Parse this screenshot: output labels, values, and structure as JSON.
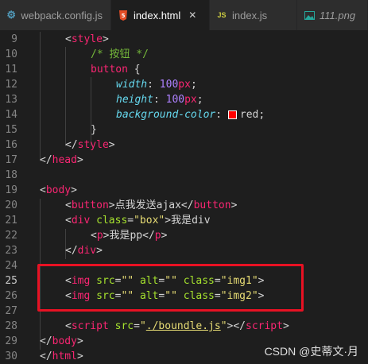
{
  "tabs": [
    {
      "label": "webpack.config.js",
      "icon": "gear-icon"
    },
    {
      "label": "index.html",
      "icon": "html5-icon",
      "close": "✕"
    },
    {
      "label": "index.js",
      "icon": "js-icon"
    },
    {
      "label": "111.png",
      "icon": "image-icon"
    }
  ],
  "lines": [
    {
      "n": "9",
      "t": [
        [
          "<",
          "br"
        ],
        [
          "style",
          "tag"
        ],
        [
          ">",
          "br"
        ]
      ]
    },
    {
      "n": "10",
      "t": [
        [
          "/* 按钮 */",
          "com"
        ]
      ]
    },
    {
      "n": "11",
      "t": [
        [
          "button",
          "sel"
        ],
        [
          " {",
          "br"
        ]
      ]
    },
    {
      "n": "12",
      "t": [
        [
          "width",
          "prop"
        ],
        [
          ": ",
          "br"
        ],
        [
          "100",
          "num"
        ],
        [
          "px",
          "unit"
        ],
        [
          ";",
          "br"
        ]
      ]
    },
    {
      "n": "13",
      "t": [
        [
          "height",
          "prop"
        ],
        [
          ": ",
          "br"
        ],
        [
          "100",
          "num"
        ],
        [
          "px",
          "unit"
        ],
        [
          ";",
          "br"
        ]
      ]
    },
    {
      "n": "14",
      "t": [
        [
          "background-color",
          "prop"
        ],
        [
          ": ",
          "br"
        ],
        [
          "",
          "swatch"
        ],
        [
          "red",
          "br"
        ],
        [
          ";",
          "br"
        ]
      ]
    },
    {
      "n": "15",
      "t": [
        [
          "}",
          "br"
        ]
      ]
    },
    {
      "n": "16",
      "t": [
        [
          "</",
          "br"
        ],
        [
          "style",
          "tag"
        ],
        [
          ">",
          "br"
        ]
      ]
    },
    {
      "n": "17",
      "t": [
        [
          "</",
          "br"
        ],
        [
          "head",
          "tag"
        ],
        [
          ">",
          "br"
        ]
      ]
    },
    {
      "n": "18",
      "t": []
    },
    {
      "n": "19",
      "t": [
        [
          "<",
          "br"
        ],
        [
          "body",
          "tag"
        ],
        [
          ">",
          "br"
        ]
      ]
    },
    {
      "n": "20",
      "t": [
        [
          "<",
          "br"
        ],
        [
          "button",
          "tag"
        ],
        [
          ">点我发送ajax</",
          "br"
        ],
        [
          "button",
          "tag"
        ],
        [
          ">",
          "br"
        ]
      ]
    },
    {
      "n": "21",
      "t": [
        [
          "<",
          "br"
        ],
        [
          "div",
          "tag"
        ],
        [
          " ",
          "br"
        ],
        [
          "class",
          "attr"
        ],
        [
          "=",
          "br"
        ],
        [
          "\"box\"",
          "str"
        ],
        [
          ">我是div",
          "br"
        ]
      ]
    },
    {
      "n": "22",
      "t": [
        [
          "<",
          "br"
        ],
        [
          "p",
          "tag"
        ],
        [
          ">我是pp</",
          "br"
        ],
        [
          "p",
          "tag"
        ],
        [
          ">",
          "br"
        ]
      ]
    },
    {
      "n": "23",
      "t": [
        [
          "</",
          "br"
        ],
        [
          "div",
          "tag"
        ],
        [
          ">",
          "br"
        ]
      ]
    },
    {
      "n": "24",
      "t": []
    },
    {
      "n": "25",
      "t": [
        [
          "<",
          "br"
        ],
        [
          "img",
          "tag"
        ],
        [
          " ",
          "br"
        ],
        [
          "src",
          "attr"
        ],
        [
          "=",
          "br"
        ],
        [
          "\"\"",
          "str"
        ],
        [
          " ",
          "br"
        ],
        [
          "alt",
          "attr"
        ],
        [
          "=",
          "br"
        ],
        [
          "\"\"",
          "str"
        ],
        [
          " ",
          "br"
        ],
        [
          "class",
          "attr"
        ],
        [
          "=",
          "br"
        ],
        [
          "\"img1\"",
          "str"
        ],
        [
          ">",
          "br"
        ]
      ]
    },
    {
      "n": "26",
      "t": [
        [
          "<",
          "br"
        ],
        [
          "img",
          "tag"
        ],
        [
          " ",
          "br"
        ],
        [
          "src",
          "attr"
        ],
        [
          "=",
          "br"
        ],
        [
          "\"\"",
          "str"
        ],
        [
          " ",
          "br"
        ],
        [
          "alt",
          "attr"
        ],
        [
          "=",
          "br"
        ],
        [
          "\"\"",
          "str"
        ],
        [
          " ",
          "br"
        ],
        [
          "class",
          "attr"
        ],
        [
          "=",
          "br"
        ],
        [
          "\"img2\"",
          "str"
        ],
        [
          ">",
          "br"
        ]
      ]
    },
    {
      "n": "27",
      "t": []
    },
    {
      "n": "28",
      "t": [
        [
          "<",
          "br"
        ],
        [
          "script",
          "tag"
        ],
        [
          " ",
          "br"
        ],
        [
          "src",
          "attr"
        ],
        [
          "=",
          "br"
        ],
        [
          "\"",
          "str"
        ],
        [
          "./boundle.js",
          "str-u"
        ],
        [
          "\"",
          "str"
        ],
        [
          "></",
          "br"
        ],
        [
          "script",
          "tag"
        ],
        [
          ">",
          "br"
        ]
      ]
    },
    {
      "n": "29",
      "t": [
        [
          "</",
          "br"
        ],
        [
          "body",
          "tag"
        ],
        [
          ">",
          "br"
        ]
      ]
    },
    {
      "n": "30",
      "t": [
        [
          "</",
          "br"
        ],
        [
          "html",
          "tag"
        ],
        [
          ">",
          "br"
        ]
      ]
    }
  ],
  "watermark": "CSDN @史蒂文·月"
}
